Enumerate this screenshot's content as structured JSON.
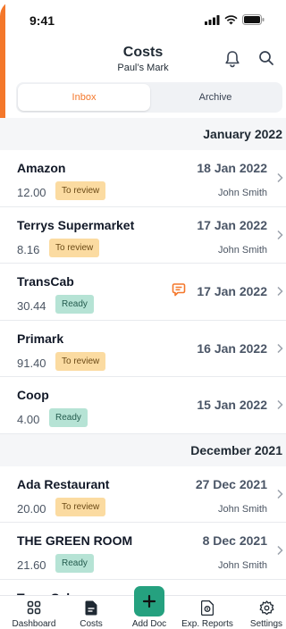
{
  "status_bar": {
    "time": "9:41"
  },
  "header": {
    "title": "Costs",
    "subtitle": "Paul’s Mark"
  },
  "segments": {
    "inbox": "Inbox",
    "archive": "Archive"
  },
  "groups": [
    {
      "label": "January 2022",
      "items": [
        {
          "merchant": "Amazon",
          "amount": "12.00",
          "status": "To review",
          "date": "18 Jan 2022",
          "person": "John Smith"
        },
        {
          "merchant": "Terrys Supermarket",
          "amount": "8.16",
          "status": "To review",
          "date": "17 Jan 2022",
          "person": "John Smith"
        },
        {
          "merchant": "TransCab",
          "amount": "30.44",
          "status": "Ready",
          "date": "17 Jan 2022",
          "person": ""
        },
        {
          "merchant": "Primark",
          "amount": "91.40",
          "status": "To review",
          "date": "16 Jan 2022",
          "person": ""
        },
        {
          "merchant": "Coop",
          "amount": "4.00",
          "status": "Ready",
          "date": "15 Jan 2022",
          "person": ""
        }
      ]
    },
    {
      "label": "December 2021",
      "items": [
        {
          "merchant": "Ada Restaurant",
          "amount": "20.00",
          "status": "To review",
          "date": "27 Dec 2021",
          "person": "John Smith"
        },
        {
          "merchant": "THE GREEN ROOM",
          "amount": "21.60",
          "status": "Ready",
          "date": "8 Dec 2021",
          "person": "John Smith"
        },
        {
          "merchant": "TransCab"
        }
      ]
    }
  ],
  "tabbar": {
    "dashboard": "Dashboard",
    "costs": "Costs",
    "add_doc": "Add Doc",
    "exp_reports": "Exp. Reports",
    "settings": "Settings"
  },
  "colors": {
    "accent": "#f4772a",
    "green": "#25a17f",
    "review_badge": "#fbdba1",
    "ready_badge": "#b6e3d5"
  }
}
